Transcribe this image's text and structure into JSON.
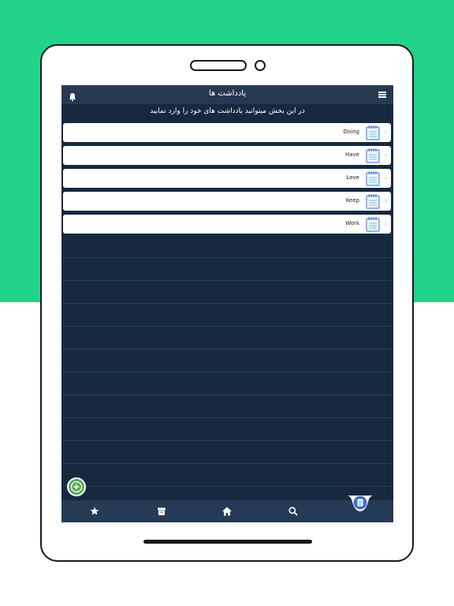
{
  "header": {
    "title": "یادداشت ها"
  },
  "subtitle": "در این بخش میتوانید یادداشت های خود را وارد نمایید",
  "notes": [
    {
      "label": "Doing"
    },
    {
      "label": "Have"
    },
    {
      "label": "Love"
    },
    {
      "label": "Keep"
    },
    {
      "label": "Work"
    }
  ],
  "icons": {
    "menu": "menu-icon",
    "bell": "bell-icon",
    "note": "notepad-icon",
    "add": "plus-icon",
    "tabs": [
      "star-icon",
      "archive-icon",
      "home-icon",
      "search-icon",
      "document-icon"
    ]
  },
  "colors": {
    "background_top": "#22d38a",
    "screen_bg": "#17293f",
    "topbar_bg": "#273950",
    "bottombar_bg": "#243a55",
    "fab": "#5aa85a",
    "note_icon": "#3b6fd0"
  }
}
